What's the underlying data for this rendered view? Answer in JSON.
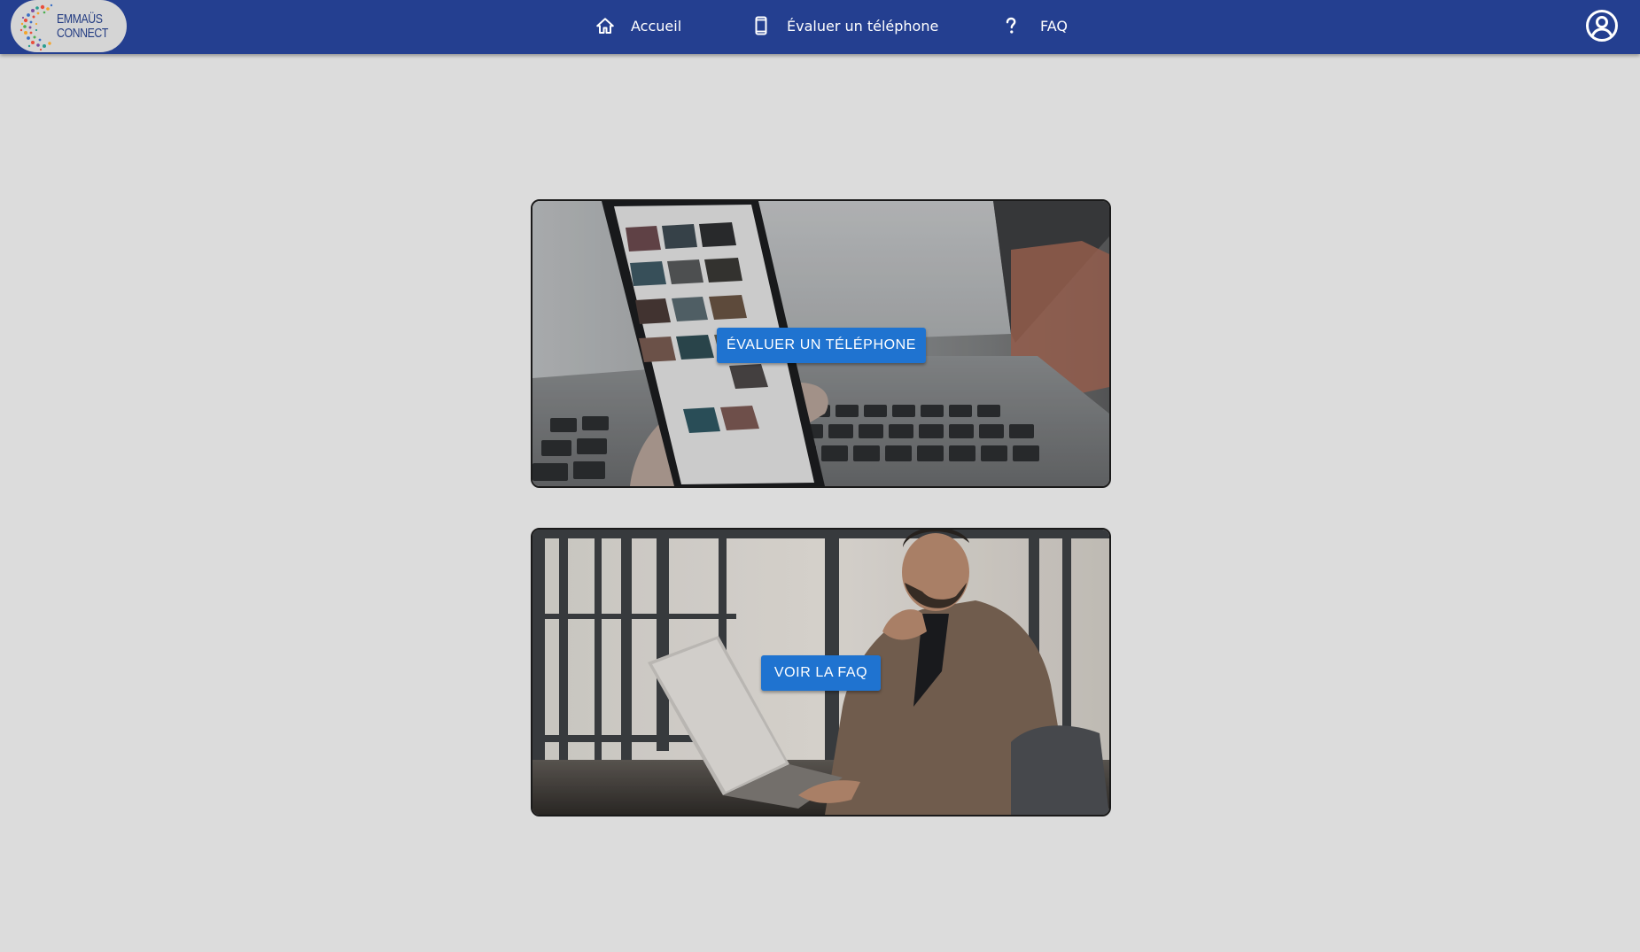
{
  "header": {
    "logo": {
      "line1": "EMMAÜS",
      "line2": "CONNECT"
    },
    "nav": [
      {
        "label": "Accueil",
        "icon": "home-icon"
      },
      {
        "label": "Évaluer un téléphone",
        "icon": "smartphone-icon"
      },
      {
        "label": "FAQ",
        "icon": "question-mark-icon"
      }
    ],
    "account_icon": "account-circle-icon"
  },
  "cards": [
    {
      "button_label": "ÉVALUER UN TÉLÉPHONE",
      "image": "hand-holding-smartphone-photo"
    },
    {
      "button_label": "VOIR LA FAQ",
      "image": "man-using-laptop-photo"
    }
  ],
  "colors": {
    "header_background": "#243f90",
    "page_background": "#dcdcdc",
    "button_background": "#1f73d0",
    "header_text": "#ffffff"
  }
}
